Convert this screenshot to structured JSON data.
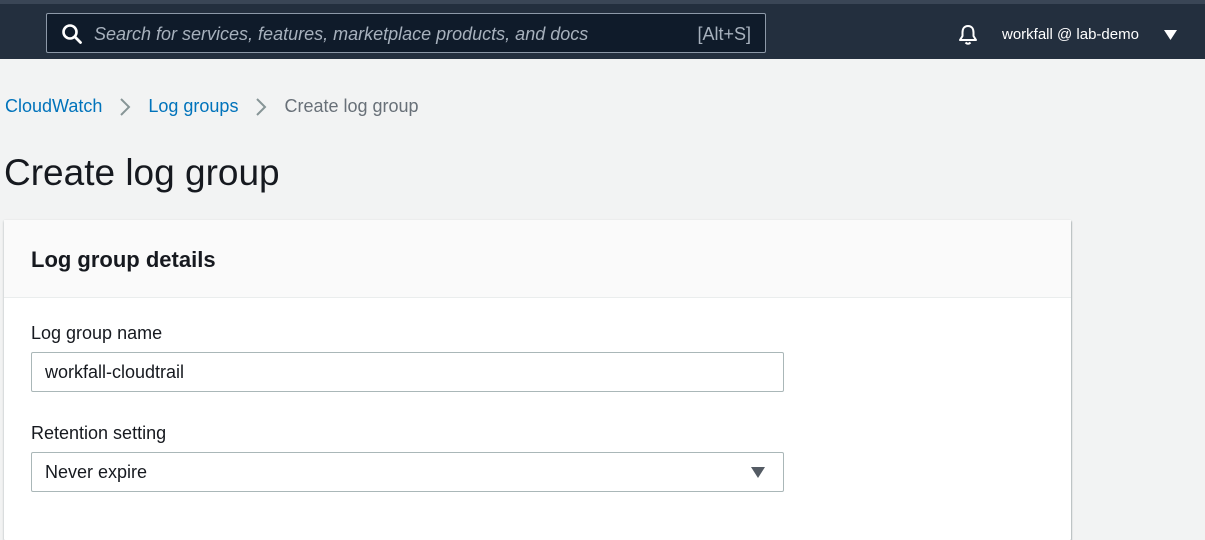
{
  "topbar": {
    "search_placeholder": "Search for services, features, marketplace products, and docs",
    "search_shortcut": "[Alt+S]",
    "account_label": "workfall @ lab-demo"
  },
  "breadcrumb": {
    "items": [
      "CloudWatch",
      "Log groups",
      "Create log group"
    ]
  },
  "page": {
    "title": "Create log group"
  },
  "panel": {
    "title": "Log group details",
    "name_label": "Log group name",
    "name_value": "workfall-cloudtrail",
    "retention_label": "Retention setting",
    "retention_value": "Never expire"
  },
  "colors": {
    "topbar_bg": "#232f3e",
    "link": "#0073bb",
    "page_bg": "#f2f3f3"
  }
}
